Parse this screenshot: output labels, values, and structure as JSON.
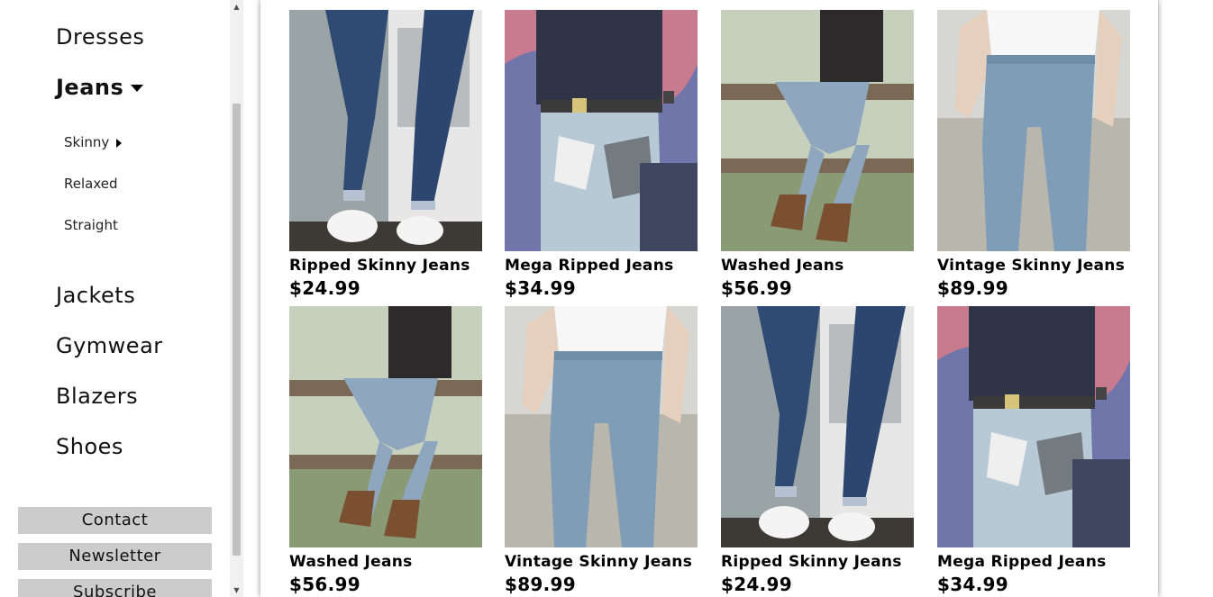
{
  "sidebar": {
    "categories": {
      "dresses": "Dresses",
      "jeans": "Jeans",
      "jackets": "Jackets",
      "gymwear": "Gymwear",
      "blazers": "Blazers",
      "shoes": "Shoes"
    },
    "jeans_subcategories": [
      "Skinny",
      "Relaxed",
      "Straight"
    ],
    "buttons": {
      "contact": "Contact",
      "newsletter": "Newsletter",
      "subscribe": "Subscribe"
    }
  },
  "products": [
    {
      "name": "Ripped Skinny Jeans",
      "price": "$24.99",
      "image": "ripped-skinny"
    },
    {
      "name": "Mega Ripped Jeans",
      "price": "$34.99",
      "image": "mega-ripped"
    },
    {
      "name": "Washed Jeans",
      "price": "$56.99",
      "image": "washed"
    },
    {
      "name": "Vintage Skinny Jeans",
      "price": "$89.99",
      "image": "vintage-skinny"
    },
    {
      "name": "Washed Jeans",
      "price": "$56.99",
      "image": "washed"
    },
    {
      "name": "Vintage Skinny Jeans",
      "price": "$89.99",
      "image": "vintage-skinny"
    },
    {
      "name": "Ripped Skinny Jeans",
      "price": "$24.99",
      "image": "ripped-skinny"
    },
    {
      "name": "Mega Ripped Jeans",
      "price": "$34.99",
      "image": "mega-ripped"
    }
  ]
}
